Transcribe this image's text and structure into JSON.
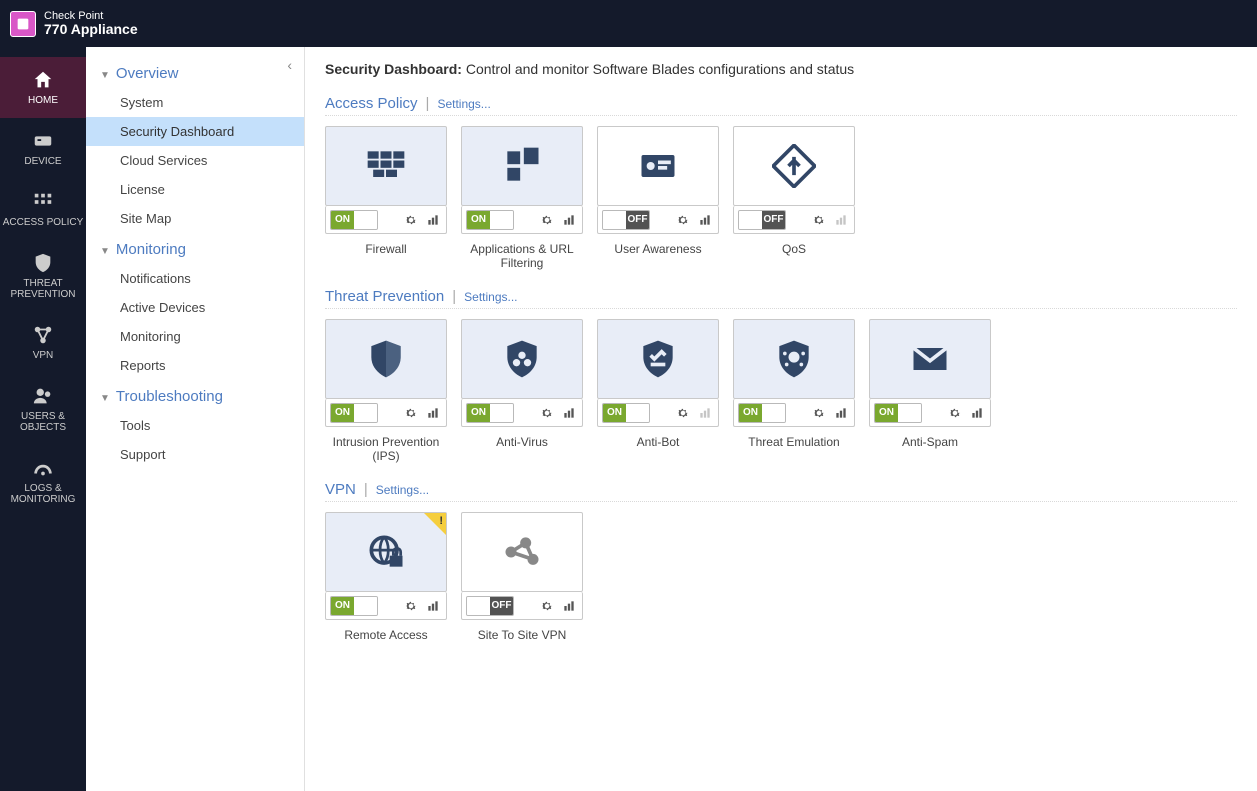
{
  "brand": {
    "line1": "Check Point",
    "line2": "770 Appliance"
  },
  "navrail": [
    {
      "id": "home",
      "label": "HOME",
      "active": true
    },
    {
      "id": "device",
      "label": "DEVICE",
      "active": false
    },
    {
      "id": "access-policy",
      "label": "ACCESS POLICY",
      "active": false
    },
    {
      "id": "threat-prevention",
      "label": "THREAT PREVENTION",
      "active": false
    },
    {
      "id": "vpn",
      "label": "VPN",
      "active": false
    },
    {
      "id": "users-objects",
      "label": "USERS & OBJECTS",
      "active": false
    },
    {
      "id": "logs-monitoring",
      "label": "LOGS & MONITORING",
      "active": false
    }
  ],
  "subnav": {
    "groups": [
      {
        "title": "Overview",
        "items": [
          {
            "label": "System",
            "active": false
          },
          {
            "label": "Security Dashboard",
            "active": true
          },
          {
            "label": "Cloud Services",
            "active": false
          },
          {
            "label": "License",
            "active": false
          },
          {
            "label": "Site Map",
            "active": false
          }
        ]
      },
      {
        "title": "Monitoring",
        "items": [
          {
            "label": "Notifications",
            "active": false
          },
          {
            "label": "Active Devices",
            "active": false
          },
          {
            "label": "Monitoring",
            "active": false
          },
          {
            "label": "Reports",
            "active": false
          }
        ]
      },
      {
        "title": "Troubleshooting",
        "items": [
          {
            "label": "Tools",
            "active": false
          },
          {
            "label": "Support",
            "active": false
          }
        ]
      }
    ]
  },
  "page": {
    "title": "Security Dashboard:",
    "subtitle": "Control and monitor Software Blades configurations and status"
  },
  "sections": [
    {
      "id": "access-policy",
      "title": "Access Policy",
      "settings": "Settings...",
      "cards": [
        {
          "id": "firewall",
          "label": "Firewall",
          "on": true,
          "icon": "firewall",
          "stats_dim": false,
          "warn": false
        },
        {
          "id": "apps",
          "label": "Applications & URL Filtering",
          "on": true,
          "icon": "apps",
          "stats_dim": false,
          "warn": false
        },
        {
          "id": "user-aware",
          "label": "User Awareness",
          "on": false,
          "icon": "idcard",
          "stats_dim": false,
          "warn": false
        },
        {
          "id": "qos",
          "label": "QoS",
          "on": false,
          "icon": "qos",
          "stats_dim": true,
          "warn": false
        }
      ]
    },
    {
      "id": "threat-prevention",
      "title": "Threat Prevention",
      "settings": "Settings...",
      "cards": [
        {
          "id": "ips",
          "label": "Intrusion Prevention (IPS)",
          "on": true,
          "icon": "shield-half",
          "stats_dim": false,
          "warn": false
        },
        {
          "id": "av",
          "label": "Anti-Virus",
          "on": true,
          "icon": "shield-bio",
          "stats_dim": false,
          "warn": false
        },
        {
          "id": "ab",
          "label": "Anti-Bot",
          "on": true,
          "icon": "shield-bot",
          "stats_dim": true,
          "warn": false
        },
        {
          "id": "te",
          "label": "Threat Emulation",
          "on": true,
          "icon": "shield-virus",
          "stats_dim": false,
          "warn": false
        },
        {
          "id": "as",
          "label": "Anti-Spam",
          "on": true,
          "icon": "envelope",
          "stats_dim": false,
          "warn": false
        }
      ]
    },
    {
      "id": "vpn",
      "title": "VPN",
      "settings": "Settings...",
      "cards": [
        {
          "id": "ra",
          "label": "Remote Access",
          "on": true,
          "icon": "globe-lock",
          "stats_dim": false,
          "warn": true
        },
        {
          "id": "s2s",
          "label": "Site To Site VPN",
          "on": false,
          "icon": "nodes",
          "stats_dim": false,
          "warn": false
        }
      ]
    }
  ],
  "toggle_labels": {
    "on": "ON",
    "off": "OFF"
  }
}
